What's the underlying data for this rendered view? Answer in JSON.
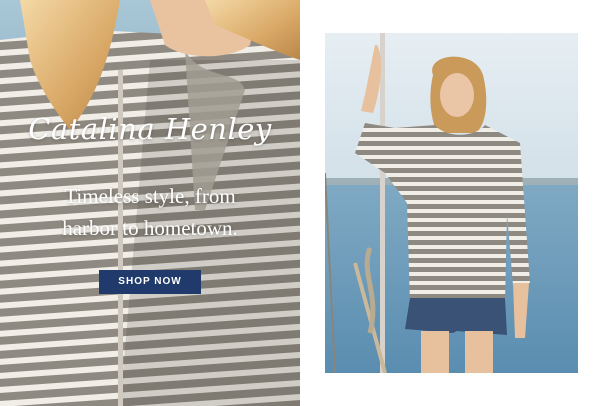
{
  "hero": {
    "title": "Catalina Henley",
    "subtitle_line1": "Timeless style, from",
    "subtitle_line2": "harbor to hometown.",
    "cta_label": "SHOP NOW"
  },
  "colors": {
    "cta_background": "#1f3a6b",
    "stripe_gray": "#8e8a82",
    "stripe_white": "#f2efe9",
    "sea": "#5f93b4",
    "sky": "#dce8ef"
  }
}
